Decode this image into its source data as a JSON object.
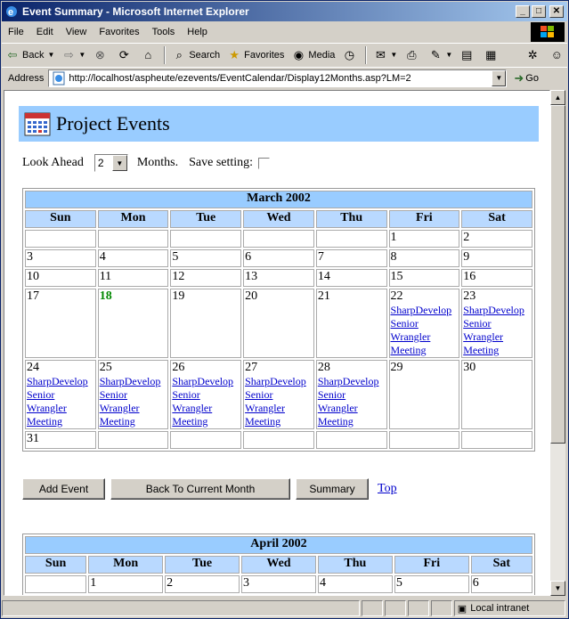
{
  "window": {
    "title": "Event Summary - Microsoft Internet Explorer"
  },
  "menu": [
    "File",
    "Edit",
    "View",
    "Favorites",
    "Tools",
    "Help"
  ],
  "toolbar": {
    "back": "Back",
    "search": "Search",
    "favorites": "Favorites",
    "media": "Media"
  },
  "address": {
    "label": "Address",
    "url": "http://localhost/aspheute/ezevents/EventCalendar/Display12Months.asp?LM=2",
    "go": "Go"
  },
  "status": {
    "zone": "Local intranet"
  },
  "page": {
    "title": "Project Events",
    "look_ahead_label": "Look Ahead",
    "look_ahead_value": "2",
    "months_label": "Months.",
    "save_label": "Save setting:"
  },
  "weekdays": [
    "Sun",
    "Mon",
    "Tue",
    "Wed",
    "Thu",
    "Fri",
    "Sat"
  ],
  "event_text": [
    "SharpDevelop",
    "Senior",
    "Wrangler",
    "Meeting"
  ],
  "march": {
    "title": "March 2002",
    "weeks": [
      [
        "",
        "",
        "",
        "",
        "",
        "1",
        "2"
      ],
      [
        "3",
        "4",
        "5",
        "6",
        "7",
        "8",
        "9"
      ],
      [
        "10",
        "11",
        "12",
        "13",
        "14",
        "15",
        "16"
      ],
      [
        "17",
        "18",
        "19",
        "20",
        "21",
        "22",
        "23"
      ],
      [
        "24",
        "25",
        "26",
        "27",
        "28",
        "29",
        "30"
      ],
      [
        "31",
        "",
        "",
        "",
        "",
        "",
        ""
      ]
    ],
    "today": "18",
    "event_days": [
      "22",
      "23",
      "24",
      "25",
      "26",
      "27",
      "28"
    ]
  },
  "buttons": {
    "add": "Add Event",
    "back_current": "Back To Current Month",
    "summary": "Summary",
    "top": "Top"
  },
  "april": {
    "title": "April 2002",
    "weeks": [
      [
        "",
        "1",
        "2",
        "3",
        "4",
        "5",
        "6"
      ]
    ]
  }
}
